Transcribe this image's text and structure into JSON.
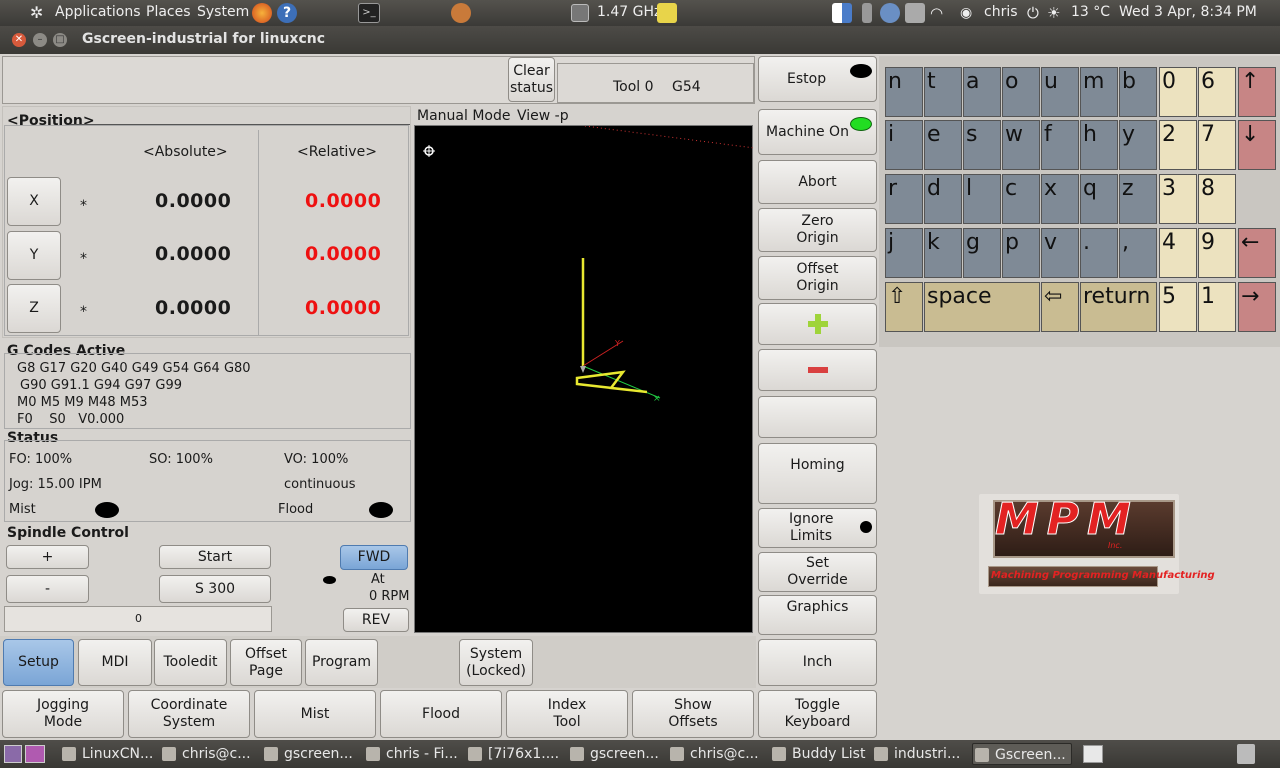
{
  "top_panel": {
    "menus": [
      "Applications",
      "Places",
      "System"
    ],
    "cpu_freq": "1.47",
    "cpu_unit": "GHz",
    "user": "chris",
    "temperature": "13 °C",
    "datetime": "Wed  3 Apr,  8:34 PM"
  },
  "window": {
    "title": "Gscreen-industrial for linuxcnc"
  },
  "header": {
    "clear_status": "Clear status",
    "tool": "Tool 0",
    "offset": "G54"
  },
  "position": {
    "title": "<Position>",
    "absolute_label": "<Absolute>",
    "relative_label": "<Relative>",
    "axes": [
      {
        "name": "X",
        "marker": "*",
        "absolute": "0.0000",
        "relative": "0.0000"
      },
      {
        "name": "Y",
        "marker": "*",
        "absolute": "0.0000",
        "relative": "0.0000"
      },
      {
        "name": "Z",
        "marker": "*",
        "absolute": "0.0000",
        "relative": "0.0000"
      }
    ]
  },
  "gcodes": {
    "title": "G Codes Active",
    "line1": "G8 G17 G20 G40 G49 G54 G64 G80",
    "line2": "G90 G91.1 G94 G97 G99",
    "line3": "M0 M5 M9 M48 M53",
    "line4": "F0    S0   V0.000"
  },
  "status": {
    "title": "Status",
    "fo": "FO: 100%",
    "so": "SO: 100%",
    "vo": "VO: 100%",
    "jog": "Jog: 15.00 IPM",
    "jog_mode": "continuous",
    "mist": "Mist",
    "flood": "Flood"
  },
  "spindle": {
    "title": "Spindle Control",
    "plus": "+",
    "minus": "-",
    "start": "Start",
    "speed": "S 300",
    "fwd": "FWD",
    "rev": "REV",
    "at": "At",
    "rpm": "0 RPM",
    "bar_value": "0"
  },
  "preview": {
    "mode": "Manual Mode",
    "view": "View -p"
  },
  "right_buttons": {
    "estop": "Estop",
    "machine_on": "Machine On",
    "abort": "Abort",
    "zero_origin": "Zero Origin",
    "offset_origin": "Offset Origin",
    "homing": "Homing",
    "ignore_limits": "Ignore Limits",
    "set_override": "Set Override",
    "graphics": "Graphics",
    "inch": "Inch",
    "toggle_keyboard": "Toggle Keyboard"
  },
  "tabs": {
    "setup": "Setup",
    "mdi": "MDI",
    "tooledit": "Tooledit",
    "offset_page": "Offset Page",
    "program": "Program",
    "system": "System (Locked)"
  },
  "bottom_buttons": {
    "jogging_mode": "Jogging Mode",
    "coordinate_system": "Coordinate System",
    "mist": "Mist",
    "flood": "Flood",
    "index_tool": "Index Tool",
    "show_offsets": "Show Offsets"
  },
  "keyboard": {
    "row1": [
      "n",
      "t",
      "a",
      "o",
      "u",
      "m",
      "b",
      "0",
      "6",
      "↑"
    ],
    "row2": [
      "i",
      "e",
      "s",
      "w",
      "f",
      "h",
      "y",
      "2",
      "7",
      "↓"
    ],
    "row3": [
      "r",
      "d",
      "l",
      "c",
      "x",
      "q",
      "z",
      "3",
      "8"
    ],
    "row4": [
      "j",
      "k",
      "g",
      "p",
      "v",
      ".",
      ",",
      "4",
      "9",
      "←"
    ],
    "row5": [
      "⇧",
      "space",
      "⇦",
      "return",
      "5",
      "1",
      "→"
    ]
  },
  "logo": {
    "text": "MPM",
    "sub": "Inc.",
    "tagline": "Machining Programming Manufacturing"
  },
  "taskbar": [
    "LinuxCN...",
    "chris@c...",
    "gscreen...",
    "chris - Fi...",
    "[7i76x1....",
    "gscreen...",
    "chris@c...",
    "Buddy List",
    "industri...",
    "Gscreen..."
  ],
  "colors": {
    "estop_led": "#000000",
    "machine_on_led": "#22dd22",
    "red_value": "#ee1111"
  }
}
